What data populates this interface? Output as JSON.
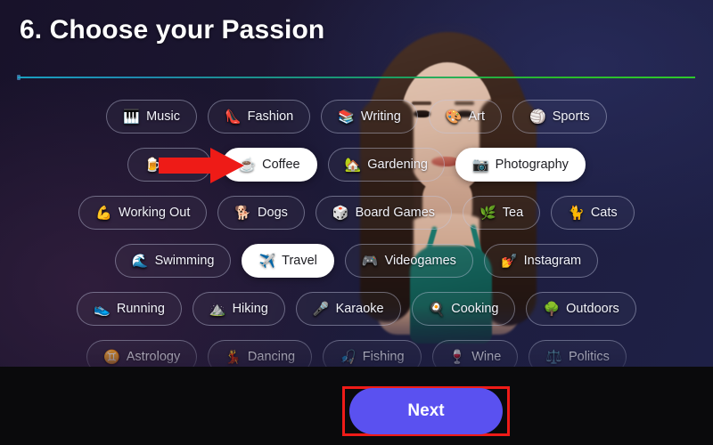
{
  "header": {
    "title": "6. Choose your Passion",
    "divider_gradient_from": "#1aa7c8",
    "divider_gradient_to": "#2fd22a"
  },
  "theme": {
    "background_dark": "#18122a",
    "background_navy": "#1e2046",
    "chip_text": "#f2f3fa",
    "chip_border": "rgba(196,200,225,0.45)",
    "selected_chip_bg": "#ffffff",
    "selected_chip_text": "#1d1d22",
    "accent_button": "#5a51f0",
    "annotation_red": "#ef1b18",
    "bottom_bar": "#0a0a0c"
  },
  "annotations": {
    "arrow": {
      "name": "red-arrow-pointing-at-coffee",
      "color": "#ee1b17",
      "points_to": "Coffee"
    },
    "highlight_box": {
      "name": "red-highlight-box-around-next",
      "color": "#ef1b18",
      "surrounds": "Next"
    }
  },
  "chips": {
    "rows": [
      [
        {
          "label": "Music",
          "emoji": "🎹",
          "icon": "piano-icon",
          "selected": false
        },
        {
          "label": "Fashion",
          "emoji": "👠",
          "icon": "high-heel-icon",
          "selected": false
        },
        {
          "label": "Writing",
          "emoji": "📚",
          "icon": "books-icon",
          "selected": false
        },
        {
          "label": "Art",
          "emoji": "🎨",
          "icon": "palette-icon",
          "selected": false
        },
        {
          "label": "Sports",
          "emoji": "🏐",
          "icon": "volleyball-icon",
          "selected": false
        }
      ],
      [
        {
          "label": "Beer",
          "emoji": "🍺",
          "icon": "beer-icon",
          "selected": false,
          "occluded_by_arrow": true
        },
        {
          "label": "Coffee",
          "emoji": "☕",
          "icon": "coffee-icon",
          "selected": true
        },
        {
          "label": "Gardening",
          "emoji": "🏡",
          "icon": "house-garden-icon",
          "selected": false
        },
        {
          "label": "Photography",
          "emoji": "📷",
          "icon": "camera-icon",
          "selected": true
        }
      ],
      [
        {
          "label": "Working Out",
          "emoji": "💪",
          "icon": "flexed-biceps-icon",
          "selected": false
        },
        {
          "label": "Dogs",
          "emoji": "🐕",
          "icon": "dog-icon",
          "selected": false
        },
        {
          "label": "Board Games",
          "emoji": "🎲",
          "icon": "dice-icon",
          "selected": false
        },
        {
          "label": "Tea",
          "emoji": "🌿",
          "icon": "herb-icon",
          "selected": false
        },
        {
          "label": "Cats",
          "emoji": "🐈",
          "icon": "cat-icon",
          "selected": false
        }
      ],
      [
        {
          "label": "Swimming",
          "emoji": "🌊",
          "icon": "wave-icon",
          "selected": false
        },
        {
          "label": "Travel",
          "emoji": "✈️",
          "icon": "airplane-icon",
          "selected": true
        },
        {
          "label": "Videogames",
          "emoji": "🎮",
          "icon": "gamepad-icon",
          "selected": false
        },
        {
          "label": "Instagram",
          "emoji": "💅",
          "icon": "nail-polish-icon",
          "selected": false
        }
      ],
      [
        {
          "label": "Running",
          "emoji": "👟",
          "icon": "sneaker-icon",
          "selected": false
        },
        {
          "label": "Hiking",
          "emoji": "⛰️",
          "icon": "mountain-icon",
          "selected": false
        },
        {
          "label": "Karaoke",
          "emoji": "🎤",
          "icon": "microphone-icon",
          "selected": false
        },
        {
          "label": "Cooking",
          "emoji": "🍳",
          "icon": "cooking-pan-icon",
          "selected": false
        },
        {
          "label": "Outdoors",
          "emoji": "🌳",
          "icon": "tree-icon",
          "selected": false
        }
      ],
      [
        {
          "label": "Astrology",
          "emoji": "♊",
          "icon": "zodiac-icon",
          "selected": false
        },
        {
          "label": "Dancing",
          "emoji": "💃",
          "icon": "dancer-icon",
          "selected": false
        },
        {
          "label": "Fishing",
          "emoji": "🎣",
          "icon": "fishing-icon",
          "selected": false
        },
        {
          "label": "Wine",
          "emoji": "🍷",
          "icon": "wine-glass-icon",
          "selected": false
        },
        {
          "label": "Politics",
          "emoji": "⚖️",
          "icon": "scales-icon",
          "selected": false
        }
      ]
    ]
  },
  "footer": {
    "next_label": "Next"
  }
}
